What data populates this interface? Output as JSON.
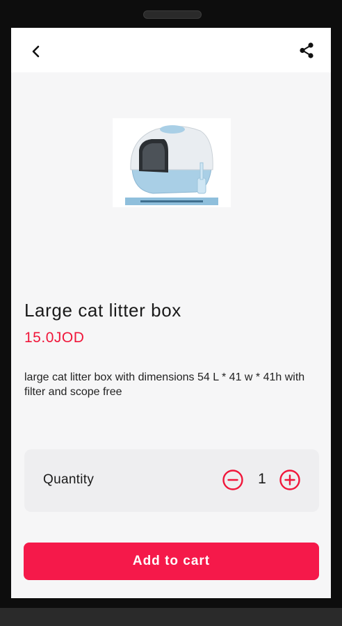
{
  "product": {
    "title": "Large cat litter box",
    "price": "15.0JOD",
    "description": "large cat litter box with dimensions 54 L * 41 w * 41h with filter and scope free",
    "image_icon": "cat-litter-box-image"
  },
  "quantity": {
    "label": "Quantity",
    "value": "1"
  },
  "actions": {
    "add_to_cart_label": "Add to cart"
  },
  "icons": {
    "back": "chevron-left-icon",
    "share": "share-icon",
    "minus": "minus-circle-icon",
    "plus": "plus-circle-icon"
  },
  "colors": {
    "accent": "#f5194a",
    "price": "#f0163a",
    "card_background": "#eeeef0"
  }
}
